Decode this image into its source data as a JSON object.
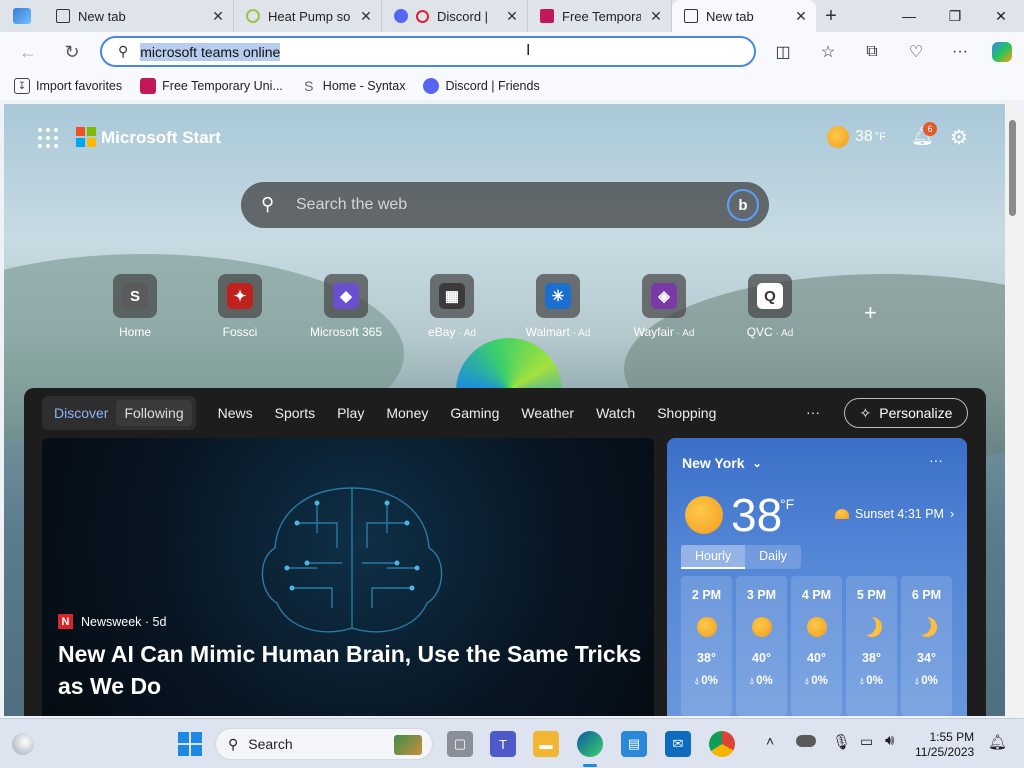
{
  "browser": {
    "tabs": [
      {
        "label": "New tab",
        "active": false
      },
      {
        "label": "Heat Pump sol",
        "active": false
      },
      {
        "label": "Discord |",
        "active": false
      },
      {
        "label": "Free Temporar",
        "active": false
      },
      {
        "label": "New tab",
        "active": true
      }
    ],
    "address_bar": {
      "value": "microsoft teams online"
    },
    "favorites": [
      {
        "label": "Import favorites",
        "icon": "import-icon"
      },
      {
        "label": "Free Temporary Uni...",
        "icon": "site-icon"
      },
      {
        "label": "Home - Syntax",
        "icon": "syntax-icon"
      },
      {
        "label": "Discord | Friends",
        "icon": "discord-icon"
      }
    ]
  },
  "start": {
    "brand": "Microsoft Start",
    "weather_temp": "38",
    "weather_unit": "°F",
    "notifications_count": "6",
    "search_placeholder": "Search the web",
    "quick_links": [
      {
        "label": "Home",
        "ad": "",
        "color": "#5b5b5b",
        "glyph": "S"
      },
      {
        "label": "Fossci",
        "ad": "",
        "color": "#c0221d",
        "glyph": "✦"
      },
      {
        "label": "Microsoft 365",
        "ad": "",
        "color": "#6b4fd1",
        "glyph": "◆"
      },
      {
        "label": "eBay",
        "ad": " · Ad",
        "color": "#3b3b3b",
        "glyph": "▦"
      },
      {
        "label": "Walmart",
        "ad": " · Ad",
        "color": "#1a6fd1",
        "glyph": "✳"
      },
      {
        "label": "Wayfair",
        "ad": " · Ad",
        "color": "#7a3aa6",
        "glyph": "◈"
      },
      {
        "label": "QVC",
        "ad": " · Ad",
        "color": "#ffffff",
        "glyph": "Q"
      }
    ],
    "feed_nav": {
      "segment": [
        "Discover",
        "Following"
      ],
      "items": [
        "News",
        "Sports",
        "Play",
        "Money",
        "Gaming",
        "Weather",
        "Watch",
        "Shopping"
      ],
      "more": "···",
      "personalize": "Personalize"
    },
    "hero": {
      "source": "Newsweek · 5d",
      "headline": "New AI Can Mimic Human Brain, Use the Same Tricks as We Do"
    },
    "weather_card": {
      "city": "New York",
      "temp": "38",
      "unit": "°F",
      "sunset": "Sunset 4:31 PM",
      "tabs": [
        "Hourly",
        "Daily"
      ],
      "hours": [
        {
          "time": "2 PM",
          "temp": "38°",
          "precip": "0%",
          "icon": "sun-icon"
        },
        {
          "time": "3 PM",
          "temp": "40°",
          "precip": "0%",
          "icon": "sun-icon"
        },
        {
          "time": "4 PM",
          "temp": "40°",
          "precip": "0%",
          "icon": "sun-icon"
        },
        {
          "time": "5 PM",
          "temp": "38°",
          "precip": "0%",
          "icon": "moon-icon"
        },
        {
          "time": "6 PM",
          "temp": "34°",
          "precip": "0%",
          "icon": "moon-icon"
        }
      ]
    }
  },
  "taskbar": {
    "search_label": "Search",
    "time": "1:55 PM",
    "date": "11/25/2023"
  }
}
